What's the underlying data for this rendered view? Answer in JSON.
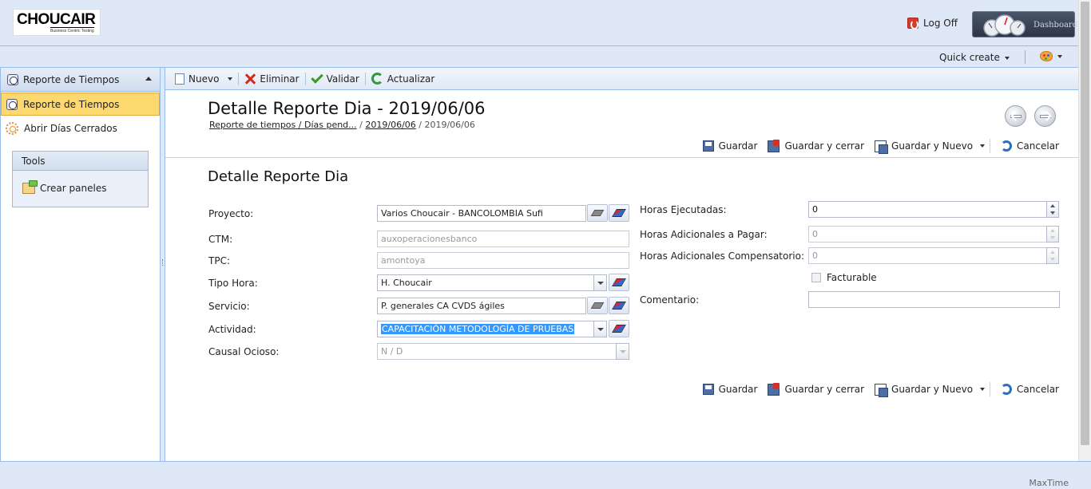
{
  "header": {
    "logo_text": "CHOUCAIR",
    "logo_tagline": "Business Centric Testing",
    "logoff_label": "Log Off",
    "dashboard_label": "Dashboard"
  },
  "qbar": {
    "quick_create_label": "Quick create"
  },
  "sidebar": {
    "header_title": "Reporte de Tiempos",
    "items": [
      {
        "label": "Reporte de Tiempos",
        "icon": "clock-icon",
        "active": true
      },
      {
        "label": "Abrir Días Cerrados",
        "icon": "gear-icon",
        "active": false
      }
    ],
    "tools_title": "Tools",
    "tools_item_label": "Crear paneles"
  },
  "toolbar": {
    "new_label": "Nuevo",
    "delete_label": "Eliminar",
    "validate_label": "Validar",
    "refresh_label": "Actualizar"
  },
  "main": {
    "title": "Detalle Reporte Dia - 2019/06/06",
    "breadcrumb": [
      {
        "label": "Reporte de tiempos / Días pend...",
        "link": true
      },
      {
        "label": "2019/06/06",
        "link": true
      },
      {
        "label": "2019/06/06",
        "link": false
      }
    ],
    "actions": {
      "save": "Guardar",
      "save_close": "Guardar y cerrar",
      "save_new": "Guardar y Nuevo",
      "cancel": "Cancelar"
    },
    "section_title": "Detalle Reporte Dia"
  },
  "form": {
    "left": {
      "proyecto": {
        "label": "Proyecto:",
        "value": "Varios Choucair - BANCOLOMBIA Sufi"
      },
      "ctm": {
        "label": "CTM:",
        "value": "auxoperacionesbanco"
      },
      "tpc": {
        "label": "TPC:",
        "value": "amontoya"
      },
      "tipo_hora": {
        "label": "Tipo Hora:",
        "value": "H. Choucair"
      },
      "servicio": {
        "label": "Servicio:",
        "value": "P. generales CA CVDS ágiles"
      },
      "actividad": {
        "label": "Actividad:",
        "value": "CAPACITACIÓN METODOLOGÍA DE PRUEBAS"
      },
      "causal_ocioso": {
        "label": "Causal Ocioso:",
        "value": "N / D"
      }
    },
    "right": {
      "horas_ejecutadas": {
        "label": "Horas Ejecutadas:",
        "value": "0"
      },
      "horas_adicionales_pagar": {
        "label": "Horas Adicionales a Pagar:",
        "value": "0"
      },
      "horas_adicionales_comp": {
        "label": "Horas Adicionales Compensatorio:",
        "value": "0"
      },
      "facturable": {
        "label": "Facturable",
        "checked": false
      },
      "comentario": {
        "label": "Comentario:",
        "value": ""
      }
    }
  },
  "footer": {
    "text": "MaxTime"
  }
}
